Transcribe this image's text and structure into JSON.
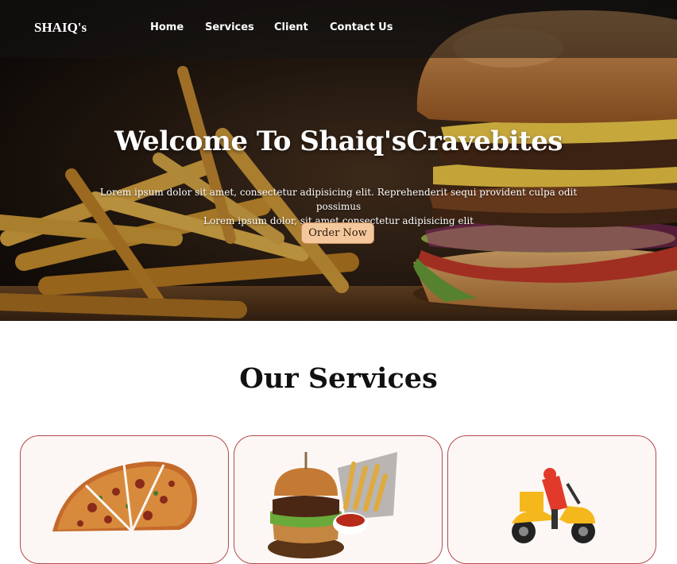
{
  "nav": {
    "brand": "SHAIQ's",
    "links": [
      "Home",
      "Services",
      "Client",
      "Contact Us"
    ]
  },
  "hero": {
    "title": "Welcome To Shaiq'sCravebites",
    "line1": "Lorem ipsum dolor sit amet, consectetur adipisicing elit. Reprehenderit sequi provident culpa odit possimus",
    "line2": "Lorem ipsum dolor, sit amet consectetur adipisicing elit",
    "button": "Order Now",
    "image": "burger-and-fries-photo"
  },
  "services": {
    "title": "Our Services",
    "cards": [
      {
        "image": "pizza-photo"
      },
      {
        "image": "burger-with-fries-photo"
      },
      {
        "image": "delivery-scooter-illustration"
      }
    ]
  },
  "colors": {
    "button_bg": "#f4c89c",
    "card_border": "#b54848",
    "card_bg": "#fcf7f4"
  }
}
